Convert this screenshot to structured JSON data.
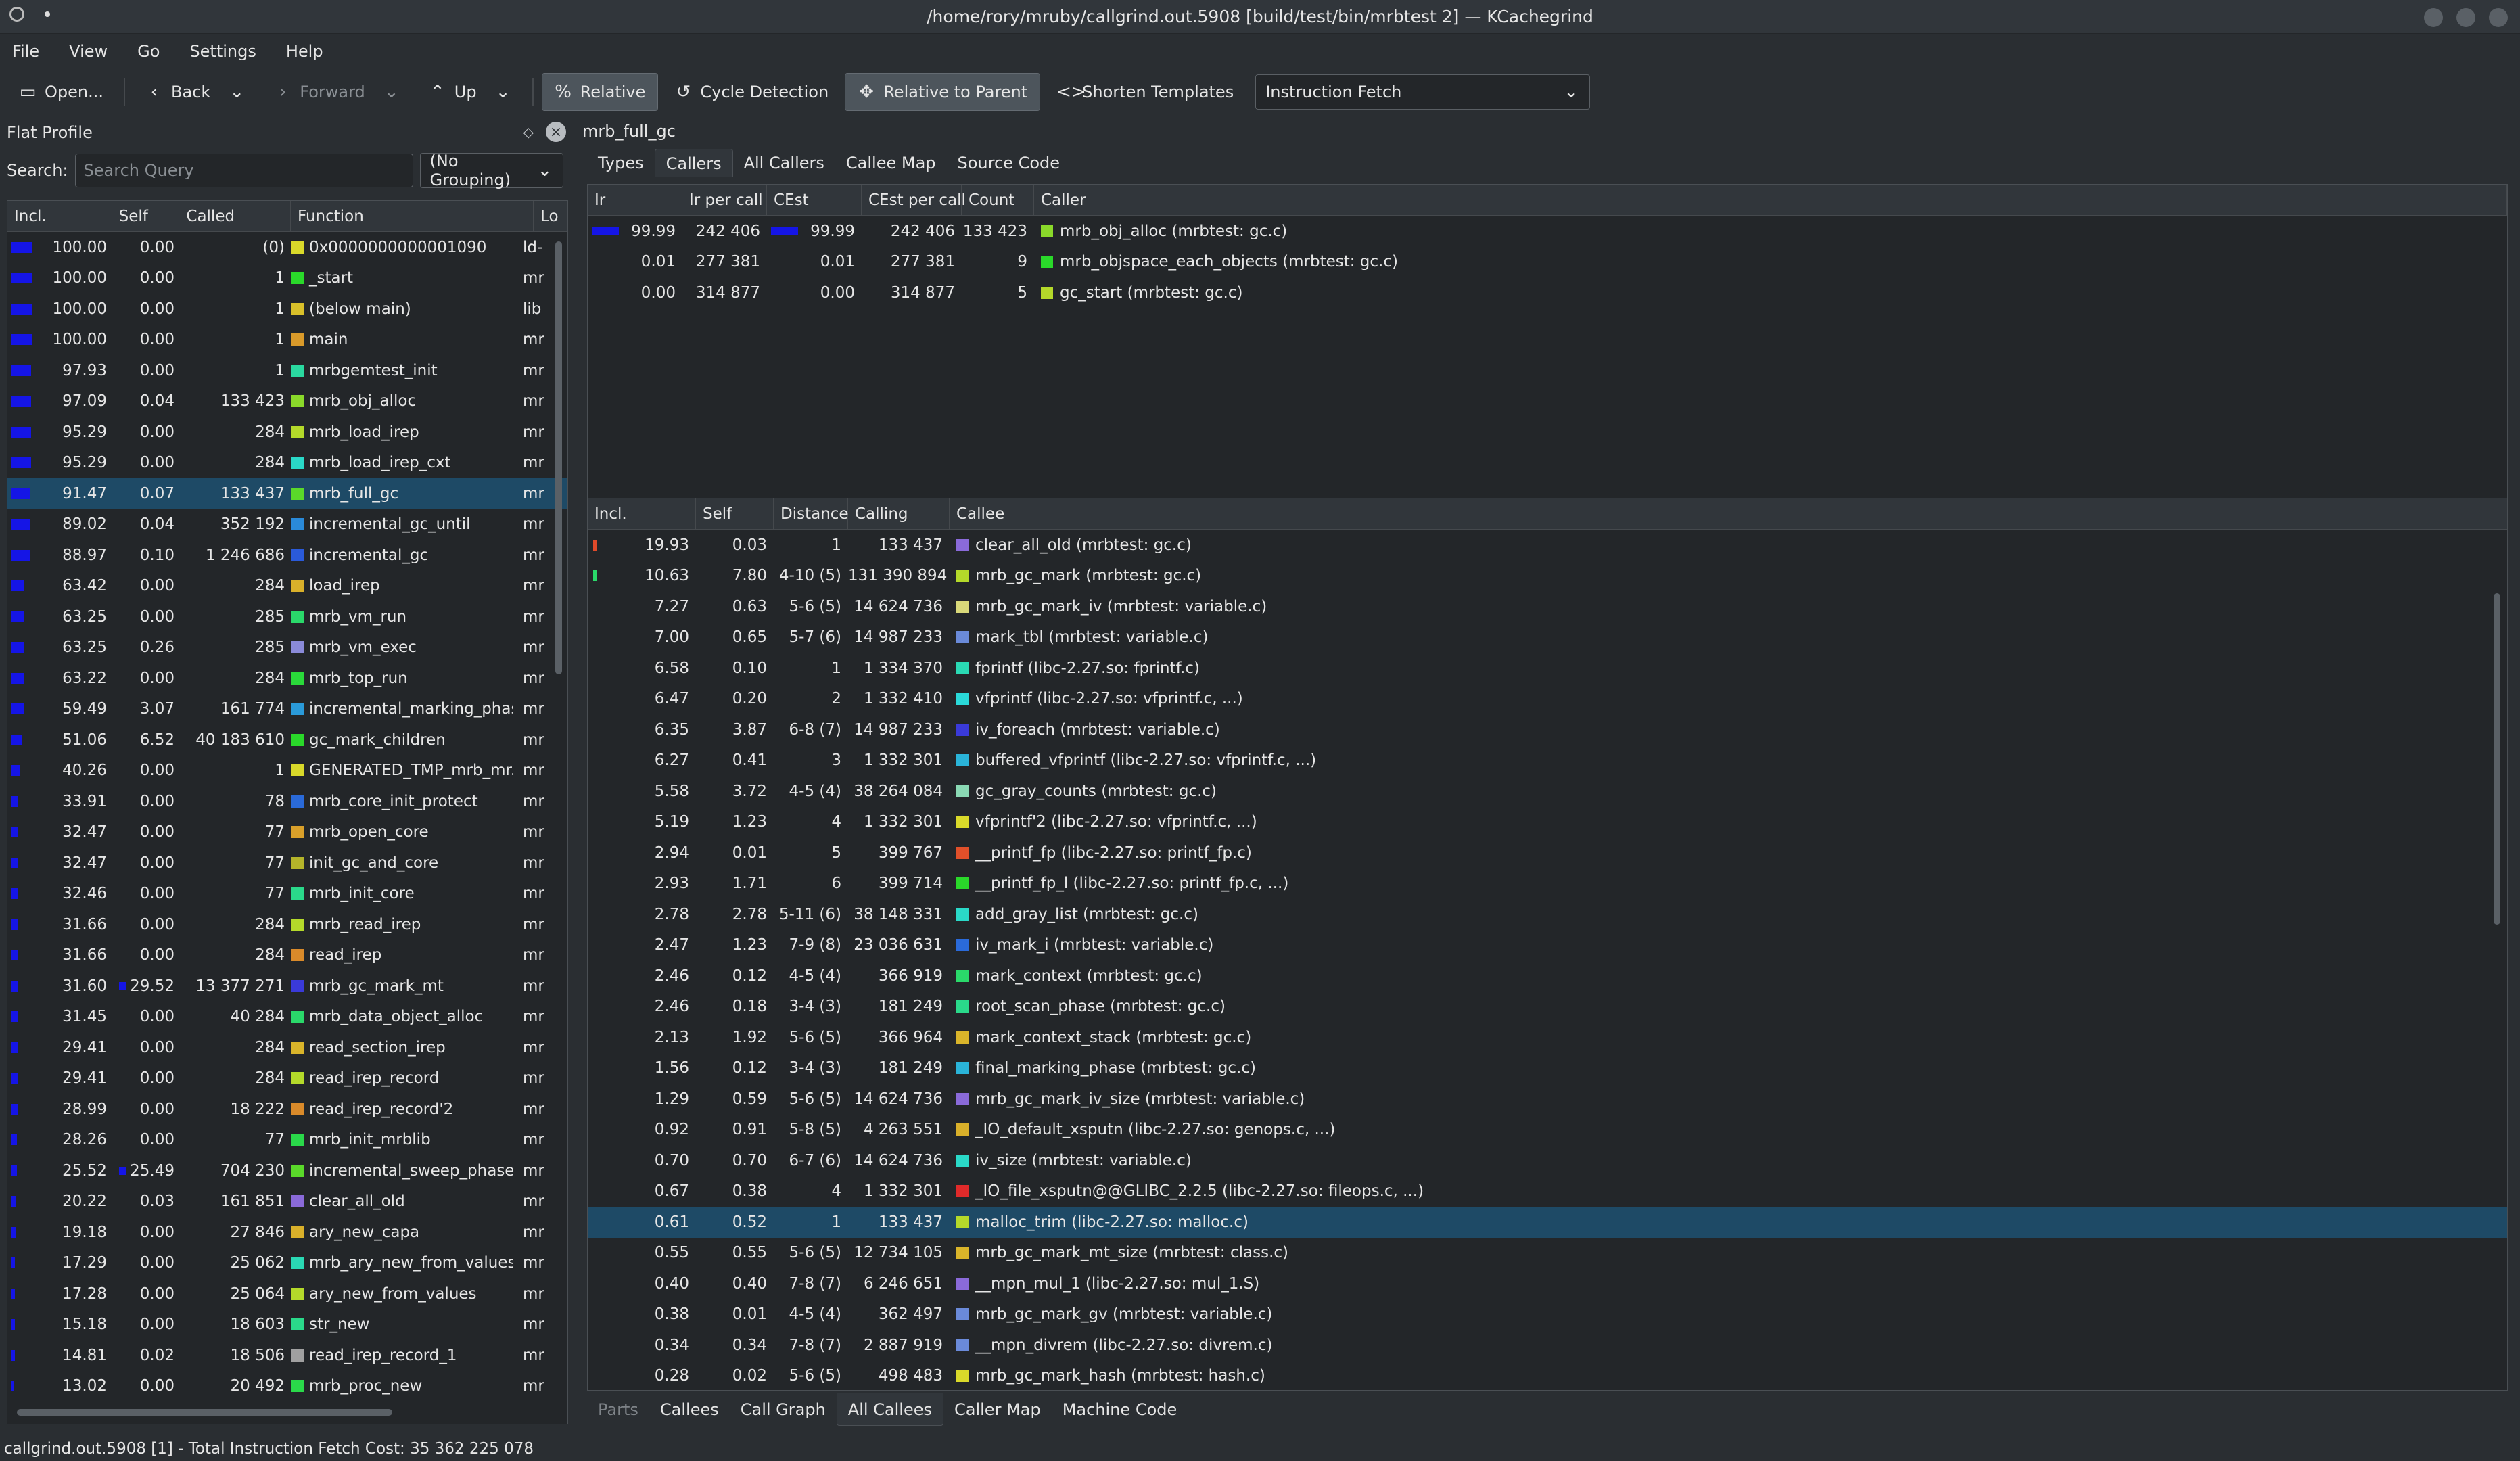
{
  "window": {
    "title": "/home/rory/mruby/callgrind.out.5908 [build/test/bin/mrbtest 2] — KCachegrind"
  },
  "menu": [
    "File",
    "View",
    "Go",
    "Settings",
    "Help"
  ],
  "toolbar": {
    "open": "Open...",
    "back": "Back",
    "forward": "Forward",
    "up": "Up",
    "relative": "Relative",
    "cycle": "Cycle Detection",
    "relparent": "Relative to Parent",
    "shorten": "Shorten Templates",
    "event": "Instruction Fetch"
  },
  "flat": {
    "title": "Flat Profile",
    "search_label": "Search:",
    "search_placeholder": "Search Query",
    "grouping": "(No Grouping)",
    "headers": [
      "Incl.",
      "Self",
      "Called",
      "Function",
      "Lo"
    ],
    "rows": [
      {
        "incl": "100.00",
        "self": "0.00",
        "called": "(0)",
        "func": "0x0000000000001090",
        "lo": "ld-",
        "color": "#d9d92a",
        "bar": 1.0
      },
      {
        "incl": "100.00",
        "self": "0.00",
        "called": "1",
        "func": "_start",
        "lo": "mr",
        "color": "#2ad92a",
        "bar": 1.0
      },
      {
        "incl": "100.00",
        "self": "0.00",
        "called": "1",
        "func": "(below main)",
        "lo": "lib",
        "color": "#d9c02a",
        "bar": 1.0
      },
      {
        "incl": "100.00",
        "self": "0.00",
        "called": "1",
        "func": "main",
        "lo": "mr",
        "color": "#d99a2a",
        "bar": 1.0
      },
      {
        "incl": "97.93",
        "self": "0.00",
        "called": "1",
        "func": "mrbgemtest_init",
        "lo": "mr",
        "color": "#2ad9a0",
        "bar": 0.98
      },
      {
        "incl": "97.09",
        "self": "0.04",
        "called": "133 423",
        "func": "mrb_obj_alloc",
        "lo": "mr",
        "color": "#8ad92a",
        "bar": 0.97
      },
      {
        "incl": "95.29",
        "self": "0.00",
        "called": "284",
        "func": "mrb_load_irep",
        "lo": "mr",
        "color": "#b4d92a",
        "bar": 0.95
      },
      {
        "incl": "95.29",
        "self": "0.00",
        "called": "284",
        "func": "mrb_load_irep_cxt",
        "lo": "mr",
        "color": "#2ad9c8",
        "bar": 0.95
      },
      {
        "incl": "91.47",
        "self": "0.07",
        "called": "133 437",
        "func": "mrb_full_gc",
        "lo": "mr",
        "color": "#5ad92a",
        "bar": 0.91
      },
      {
        "incl": "89.02",
        "self": "0.04",
        "called": "352 192",
        "func": "incremental_gc_until",
        "lo": "mr",
        "color": "#2a8ad9",
        "bar": 0.89
      },
      {
        "incl": "88.97",
        "self": "0.10",
        "called": "1 246 686",
        "func": "incremental_gc",
        "lo": "mr",
        "color": "#2a5ad9",
        "bar": 0.89
      },
      {
        "incl": "63.42",
        "self": "0.00",
        "called": "284",
        "func": "load_irep",
        "lo": "mr",
        "color": "#d9b02a",
        "bar": 0.63
      },
      {
        "incl": "63.25",
        "self": "0.00",
        "called": "285",
        "func": "mrb_vm_run",
        "lo": "mr",
        "color": "#2ad96a",
        "bar": 0.63
      },
      {
        "incl": "63.25",
        "self": "0.26",
        "called": "285",
        "func": "mrb_vm_exec",
        "lo": "mr",
        "color": "#8a8ad9",
        "bar": 0.63
      },
      {
        "incl": "63.22",
        "self": "0.00",
        "called": "284",
        "func": "mrb_top_run",
        "lo": "mr",
        "color": "#2ad93a",
        "bar": 0.63
      },
      {
        "incl": "59.49",
        "self": "3.07",
        "called": "161 774",
        "func": "incremental_marking_phase",
        "lo": "mr",
        "color": "#2a9ad9",
        "bar": 0.59
      },
      {
        "incl": "51.06",
        "self": "6.52",
        "called": "40 183 610",
        "func": "gc_mark_children",
        "lo": "mr",
        "color": "#2ad92a",
        "bar": 0.51
      },
      {
        "incl": "40.26",
        "self": "0.00",
        "called": "1",
        "func": "GENERATED_TMP_mrb_mr...",
        "lo": "mr",
        "color": "#d9d92a",
        "bar": 0.4
      },
      {
        "incl": "33.91",
        "self": "0.00",
        "called": "78",
        "func": "mrb_core_init_protect",
        "lo": "mr",
        "color": "#2a6ad9",
        "bar": 0.34
      },
      {
        "incl": "32.47",
        "self": "0.00",
        "called": "77",
        "func": "mrb_open_core",
        "lo": "mr",
        "color": "#d9a02a",
        "bar": 0.32
      },
      {
        "incl": "32.47",
        "self": "0.00",
        "called": "77",
        "func": "init_gc_and_core",
        "lo": "mr",
        "color": "#b4b42a",
        "bar": 0.32
      },
      {
        "incl": "32.46",
        "self": "0.00",
        "called": "77",
        "func": "mrb_init_core",
        "lo": "mr",
        "color": "#2ad98a",
        "bar": 0.32
      },
      {
        "incl": "31.66",
        "self": "0.00",
        "called": "284",
        "func": "mrb_read_irep",
        "lo": "mr",
        "color": "#b4d92a",
        "bar": 0.32
      },
      {
        "incl": "31.66",
        "self": "0.00",
        "called": "284",
        "func": "read_irep",
        "lo": "mr",
        "color": "#d98a2a",
        "bar": 0.32
      },
      {
        "incl": "31.60",
        "self": "29.52",
        "called": "13 377 271",
        "func": "mrb_gc_mark_mt",
        "lo": "mr",
        "color": "#3a3ad9",
        "bar": 0.32
      },
      {
        "incl": "31.45",
        "self": "0.00",
        "called": "40 284",
        "func": "mrb_data_object_alloc",
        "lo": "mr",
        "color": "#2ad96a",
        "bar": 0.31
      },
      {
        "incl": "29.41",
        "self": "0.00",
        "called": "284",
        "func": "read_section_irep",
        "lo": "mr",
        "color": "#d9b42a",
        "bar": 0.29
      },
      {
        "incl": "29.41",
        "self": "0.00",
        "called": "284",
        "func": "read_irep_record",
        "lo": "mr",
        "color": "#b4d92a",
        "bar": 0.29
      },
      {
        "incl": "28.99",
        "self": "0.00",
        "called": "18 222",
        "func": "read_irep_record'2",
        "lo": "mr",
        "color": "#d98a2a",
        "bar": 0.29
      },
      {
        "incl": "28.26",
        "self": "0.00",
        "called": "77",
        "func": "mrb_init_mrblib",
        "lo": "mr",
        "color": "#2ad94a",
        "bar": 0.28
      },
      {
        "incl": "25.52",
        "self": "25.49",
        "called": "704 230",
        "func": "incremental_sweep_phase",
        "lo": "mr",
        "color": "#5ad92a",
        "bar": 0.26
      },
      {
        "incl": "20.22",
        "self": "0.03",
        "called": "161 851",
        "func": "clear_all_old",
        "lo": "mr",
        "color": "#8a6ad9",
        "bar": 0.2
      },
      {
        "incl": "19.18",
        "self": "0.00",
        "called": "27 846",
        "func": "ary_new_capa",
        "lo": "mr",
        "color": "#d9b02a",
        "bar": 0.19
      },
      {
        "incl": "17.29",
        "self": "0.00",
        "called": "25 062",
        "func": "mrb_ary_new_from_values",
        "lo": "mr",
        "color": "#2ad9b4",
        "bar": 0.17
      },
      {
        "incl": "17.28",
        "self": "0.00",
        "called": "25 064",
        "func": "ary_new_from_values",
        "lo": "mr",
        "color": "#b4d92a",
        "bar": 0.17
      },
      {
        "incl": "15.18",
        "self": "0.00",
        "called": "18 603",
        "func": "str_new",
        "lo": "mr",
        "color": "#2ad98a",
        "bar": 0.15
      },
      {
        "incl": "14.81",
        "self": "0.02",
        "called": "18 506",
        "func": "read_irep_record_1",
        "lo": "mr",
        "color": "#a0a0a0",
        "bar": 0.15
      },
      {
        "incl": "13.02",
        "self": "0.00",
        "called": "20 492",
        "func": "mrb_proc_new",
        "lo": "mr",
        "color": "#2ad94a",
        "bar": 0.13
      }
    ]
  },
  "detail": {
    "function_name": "mrb_full_gc",
    "top_tabs": [
      "Types",
      "Callers",
      "All Callers",
      "Callee Map",
      "Source Code"
    ],
    "callers": {
      "headers": [
        "Ir",
        "Ir per call",
        "CEst",
        "CEst per call",
        "Count",
        "Caller"
      ],
      "rows": [
        {
          "ir": "99.99",
          "irpc": "242 406",
          "cest": "99.99",
          "cestpc": "242 406",
          "count": "133 423",
          "caller": "mrb_obj_alloc (mrbtest: gc.c)",
          "color": "#8ad92a",
          "bar": 1.0
        },
        {
          "ir": "0.01",
          "irpc": "277 381",
          "cest": "0.01",
          "cestpc": "277 381",
          "count": "9",
          "caller": "mrb_objspace_each_objects (mrbtest: gc.c)",
          "color": "#2ad92a",
          "bar": 0
        },
        {
          "ir": "0.00",
          "irpc": "314 877",
          "cest": "0.00",
          "cestpc": "314 877",
          "count": "5",
          "caller": "gc_start (mrbtest: gc.c)",
          "color": "#b4d92a",
          "bar": 0
        }
      ]
    },
    "callees": {
      "headers": [
        "Incl.",
        "Self",
        "Distance",
        "Calling",
        "Callee"
      ],
      "rows": [
        {
          "incl": "19.93",
          "self": "0.03",
          "dist": "1",
          "calling": "133 437",
          "callee": "clear_all_old (mrbtest: gc.c)",
          "color": "#8a6ad9",
          "mark": "#e04a2a"
        },
        {
          "incl": "10.63",
          "self": "7.80",
          "dist": "4-10 (5)",
          "calling": "131 390 894",
          "callee": "mrb_gc_mark (mrbtest: gc.c)",
          "color": "#b4d92a",
          "mark": "#2ad96a"
        },
        {
          "incl": "7.27",
          "self": "0.63",
          "dist": "5-6 (5)",
          "calling": "14 624 736",
          "callee": "mrb_gc_mark_iv (mrbtest: variable.c)",
          "color": "#d9d97a",
          "mark": ""
        },
        {
          "incl": "7.00",
          "self": "0.65",
          "dist": "5-7 (6)",
          "calling": "14 987 233",
          "callee": "mark_tbl (mrbtest: variable.c)",
          "color": "#6a8ad9",
          "mark": ""
        },
        {
          "incl": "6.58",
          "self": "0.10",
          "dist": "1",
          "calling": "1 334 370",
          "callee": "fprintf (libc-2.27.so: fprintf.c)",
          "color": "#2ad9b4",
          "mark": ""
        },
        {
          "incl": "6.47",
          "self": "0.20",
          "dist": "2",
          "calling": "1 332 410",
          "callee": "vfprintf (libc-2.27.so: vfprintf.c, ...)",
          "color": "#2ad9d9",
          "mark": ""
        },
        {
          "incl": "6.35",
          "self": "3.87",
          "dist": "6-8 (7)",
          "calling": "14 987 233",
          "callee": "iv_foreach (mrbtest: variable.c)",
          "color": "#3a3ad9",
          "mark": ""
        },
        {
          "incl": "6.27",
          "self": "0.41",
          "dist": "3",
          "calling": "1 332 301",
          "callee": "buffered_vfprintf (libc-2.27.so: vfprintf.c, ...)",
          "color": "#2ab4d9",
          "mark": ""
        },
        {
          "incl": "5.58",
          "self": "3.72",
          "dist": "4-5 (4)",
          "calling": "38 264 084",
          "callee": "gc_gray_counts (mrbtest: gc.c)",
          "color": "#8ad9b4",
          "mark": ""
        },
        {
          "incl": "5.19",
          "self": "1.23",
          "dist": "4",
          "calling": "1 332 301",
          "callee": "vfprintf'2 (libc-2.27.so: vfprintf.c, ...)",
          "color": "#d9d92a",
          "mark": ""
        },
        {
          "incl": "2.94",
          "self": "0.01",
          "dist": "5",
          "calling": "399 767",
          "callee": "__printf_fp (libc-2.27.so: printf_fp.c)",
          "color": "#e0502a",
          "mark": ""
        },
        {
          "incl": "2.93",
          "self": "1.71",
          "dist": "6",
          "calling": "399 714",
          "callee": "__printf_fp_l (libc-2.27.so: printf_fp.c, ...)",
          "color": "#2ad92a",
          "mark": ""
        },
        {
          "incl": "2.78",
          "self": "2.78",
          "dist": "5-11 (6)",
          "calling": "38 148 331",
          "callee": "add_gray_list (mrbtest: gc.c)",
          "color": "#2ad9c8",
          "mark": ""
        },
        {
          "incl": "2.47",
          "self": "1.23",
          "dist": "7-9 (8)",
          "calling": "23 036 631",
          "callee": "iv_mark_i (mrbtest: variable.c)",
          "color": "#2a6ad9",
          "mark": ""
        },
        {
          "incl": "2.46",
          "self": "0.12",
          "dist": "4-5 (4)",
          "calling": "366 919",
          "callee": "mark_context (mrbtest: gc.c)",
          "color": "#2ad96a",
          "mark": ""
        },
        {
          "incl": "2.46",
          "self": "0.18",
          "dist": "3-4 (3)",
          "calling": "181 249",
          "callee": "root_scan_phase (mrbtest: gc.c)",
          "color": "#2ad98a",
          "mark": ""
        },
        {
          "incl": "2.13",
          "self": "1.92",
          "dist": "5-6 (5)",
          "calling": "366 964",
          "callee": "mark_context_stack (mrbtest: gc.c)",
          "color": "#d9b42a",
          "mark": ""
        },
        {
          "incl": "1.56",
          "self": "0.12",
          "dist": "3-4 (3)",
          "calling": "181 249",
          "callee": "final_marking_phase (mrbtest: gc.c)",
          "color": "#2ab4d9",
          "mark": ""
        },
        {
          "incl": "1.29",
          "self": "0.59",
          "dist": "5-6 (5)",
          "calling": "14 624 736",
          "callee": "mrb_gc_mark_iv_size (mrbtest: variable.c)",
          "color": "#8a6ad9",
          "mark": ""
        },
        {
          "incl": "0.92",
          "self": "0.91",
          "dist": "5-8 (5)",
          "calling": "4 263 551",
          "callee": "_IO_default_xsputn (libc-2.27.so: genops.c, ...)",
          "color": "#d9b02a",
          "mark": ""
        },
        {
          "incl": "0.70",
          "self": "0.70",
          "dist": "6-7 (6)",
          "calling": "14 624 736",
          "callee": "iv_size (mrbtest: variable.c)",
          "color": "#2ad9c8",
          "mark": ""
        },
        {
          "incl": "0.67",
          "self": "0.38",
          "dist": "4",
          "calling": "1 332 301",
          "callee": "_IO_file_xsputn@@GLIBC_2.2.5 (libc-2.27.so: fileops.c, ...)",
          "color": "#e02a2a",
          "mark": ""
        },
        {
          "incl": "0.61",
          "self": "0.52",
          "dist": "1",
          "calling": "133 437",
          "callee": "malloc_trim (libc-2.27.so: malloc.c)",
          "color": "#b4d92a",
          "mark": ""
        },
        {
          "incl": "0.55",
          "self": "0.55",
          "dist": "5-6 (5)",
          "calling": "12 734 105",
          "callee": "mrb_gc_mark_mt_size (mrbtest: class.c)",
          "color": "#d9b42a",
          "mark": ""
        },
        {
          "incl": "0.40",
          "self": "0.40",
          "dist": "7-8 (7)",
          "calling": "6 246 651",
          "callee": "__mpn_mul_1 (libc-2.27.so: mul_1.S)",
          "color": "#8a6ad9",
          "mark": ""
        },
        {
          "incl": "0.38",
          "self": "0.01",
          "dist": "4-5 (4)",
          "calling": "362 497",
          "callee": "mrb_gc_mark_gv (mrbtest: variable.c)",
          "color": "#6a8ad9",
          "mark": ""
        },
        {
          "incl": "0.34",
          "self": "0.34",
          "dist": "7-8 (7)",
          "calling": "2 887 919",
          "callee": "__mpn_divrem (libc-2.27.so: divrem.c)",
          "color": "#6a8ad9",
          "mark": ""
        },
        {
          "incl": "0.28",
          "self": "0.02",
          "dist": "5-6 (5)",
          "calling": "498 483",
          "callee": "mrb_gc_mark_hash (mrbtest: hash.c)",
          "color": "#d9d92a",
          "mark": ""
        }
      ]
    },
    "bottom_tabs": [
      "Parts",
      "Callees",
      "Call Graph",
      "All Callees",
      "Caller Map",
      "Machine Code"
    ]
  },
  "status": "callgrind.out.5908 [1] - Total Instruction Fetch Cost: 35 362 225 078"
}
